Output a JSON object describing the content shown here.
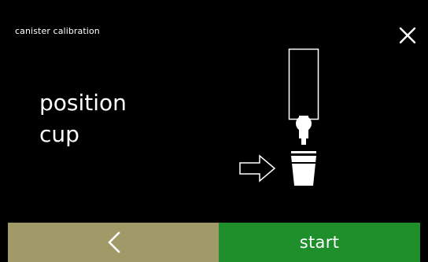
{
  "header": {
    "title": "canister calibration",
    "close_icon": "close-icon"
  },
  "main": {
    "instruction_line1": "position",
    "instruction_line2": "cup",
    "illustration_icons": [
      "canister-icon",
      "arrow-right-icon",
      "cup-icon"
    ]
  },
  "footer": {
    "back_icon": "chevron-left-icon",
    "start_label": "start"
  },
  "colors": {
    "background": "#000000",
    "text": "#ffffff",
    "back_button": "#a09a68",
    "start_button": "#1f8f2c"
  }
}
